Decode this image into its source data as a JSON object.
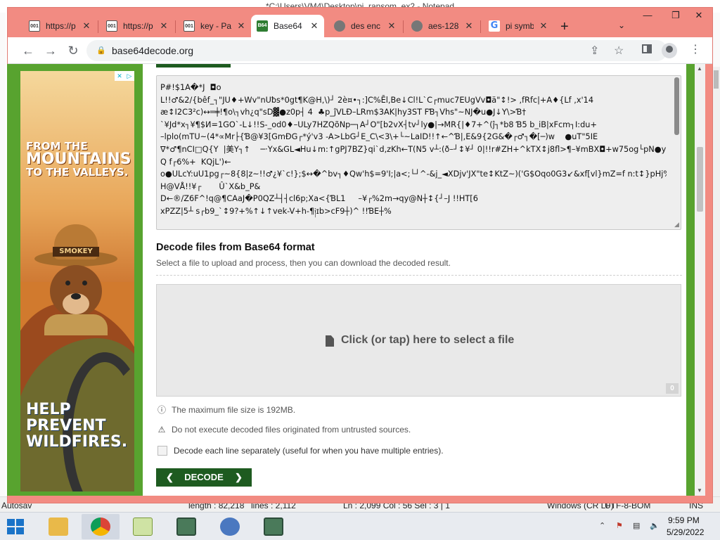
{
  "notepad": {
    "title": "*C:\\Users\\VM4\\Desktop\\pi_ransom_ex2 - Notepad",
    "status": {
      "autosave": "Autosav",
      "length": "length : 82,218",
      "lines": "lines : 2,112",
      "position": "Ln : 2,099    Col : 56    Sel : 3 | 1",
      "eol": "Windows (CR LF)",
      "encoding": "UTF-8-BOM",
      "mode": "INS"
    }
  },
  "browser": {
    "tabs": [
      {
        "label": "https://p",
        "favicon": "document-icon",
        "active": false
      },
      {
        "label": "https://p",
        "favicon": "document-icon",
        "active": false
      },
      {
        "label": "key - Pa",
        "favicon": "document-icon",
        "active": false
      },
      {
        "label": "Base64",
        "favicon": "base64-logo",
        "active": true,
        "favicon_text": "B64"
      },
      {
        "label": "des enc",
        "favicon": "globe-icon",
        "active": false
      },
      {
        "label": "aes-128",
        "favicon": "globe-icon",
        "active": false
      },
      {
        "label": "pi symb",
        "favicon": "google-icon",
        "active": false,
        "favicon_text": "G"
      }
    ],
    "new_tab": "+",
    "url": "base64decode.org"
  },
  "ad": {
    "top_line1": "FROM THE",
    "top_line2": "MOUNTAINS",
    "top_line3": "TO THE VALLEYS.",
    "hat_text": "SMOKEY",
    "bottom_line1": "HELP",
    "bottom_line2": "PREVENT",
    "bottom_line3": "WILDFIRES."
  },
  "output": {
    "text": "P#!$1A�*J  ◘o\nL!!♂&2/{bêf_┐\"JU♦+Wv\"nUƀs*0gt¶K@H,\\)┘ 2è¤•┐:]C%Ēl,Be↓Cl!L`C┌muc7EUgVv◘ä\"↕!> ,fRfc|+A♦{Lf ,x'14\næ↕I2C3²c)↔═╪!¶o\\┐vh¿q\"sD▓●z0p┤ 4  ♣p_ĵVLÐ–LRm$3AK|hy3ST FƁ┐Vhs\"~NJ�u●J↓Y\\>Ɓ†\n`¥Jd*x┐¥¶$И=1GO`-L↓!!S-_od0♦–ULy7HZQõNp─┐A┘O\"[b2vX┤tv┘ly●|→MR{|♦7+^(ĵ┐*b8 Ɓ5 b_iB|xFcm┐I:du+\n–lplο(mTU~(4*∝Mr├{Ɓ@¥3[GmÐG┌*ý'v3 -A>LbG┘E_C\\<3\\+└~LaID!!↑←^Ɓ|,E&9{2G&�┌♂┐�[─)w    ●uT\"5IE\n∇*♂¶nCI□Q{Y  |美Y┐↑    ─·Yx&GL◄Hu↓m:↑gPJ7BZ}qi`d,zKh←T(N5 v┴:(ð–┘↕¥┘ 0|!!r#ZH+^kTX↕j8fl>¶–¥mBX◘+w75og└pN●y\nQ f┌6%+  KQjL')←\no●ULcY:uU1pg┌~8{8|z~!!♂¿¥`c!};$↔�^bv┐♦Qw'h$=9'I;|a<;└┘^-&j_◄XDjv'JX\"te↕KtZ~)('G$Oqo0G3↙&xf[vl}mZ=f n:t↕}pHj%Lb\nH@VÅ!!¥┌       Û`X&b_P&\nD←®/Z6F^!q@¶CAaJ�P0QZ┴┤┤cl6p;Xa<{ƁL1     –¥┌%2m→qy@N┼↕{┘–J !!HT[6\nxPZZ|5┴ s┌b9_`↕9?+%↑↓↑vek-V+h-¶༏ɪb>cF9┼)^ !!ƁE┼%"
  },
  "decode_files": {
    "title": "Decode files from Base64 format",
    "subtitle": "Select a file to upload and process, then you can download the decoded result.",
    "dropzone_label": "Click (or tap) here to select a file",
    "file_count": "0",
    "max_size_note": "The maximum file size is 192MB.",
    "warning_note": "Do not execute decoded files originated from untrusted sources.",
    "each_line_label": "Decode each line separately (useful for when you have multiple entries).",
    "decode_button": "DECODE"
  },
  "taskbar": {
    "time": "9:59 PM",
    "date": "5/29/2022"
  },
  "colors": {
    "chrome_frame": "#f28b82",
    "site_green": "#58a32f",
    "button_dark_green": "#1e5b20"
  }
}
